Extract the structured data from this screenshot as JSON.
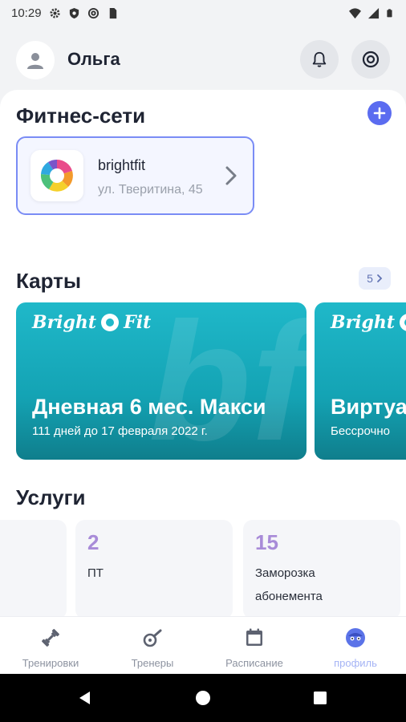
{
  "status_bar": {
    "time": "10:29"
  },
  "header": {
    "user_name": "Ольга"
  },
  "fitness": {
    "title": "Фитнес-сети",
    "club": {
      "name": "brightfit",
      "address": "ул. Тверитина, 45"
    }
  },
  "cards": {
    "title": "Карты",
    "count": "5",
    "items": [
      {
        "brand": "Bright",
        "brand2": "Fit",
        "bg_letters": "bf",
        "title": "Дневная 6 мес. Макси",
        "subtitle": "111 дней до 17 февраля 2022 г."
      },
      {
        "brand": "Bright",
        "brand2": "",
        "bg_letters": "",
        "title": "Виртуа",
        "subtitle": "Бессрочно"
      }
    ]
  },
  "services": {
    "title": "Услуги",
    "items": [
      {
        "count": "2",
        "label": "ПТ"
      },
      {
        "count": "15",
        "label": "Заморозка абонемента"
      }
    ]
  },
  "bottom_nav": {
    "items": [
      {
        "label": "Тренировки",
        "icon": "dumbbell-icon"
      },
      {
        "label": "Тренеры",
        "icon": "whistle-icon"
      },
      {
        "label": "Расписание",
        "icon": "calendar-icon"
      },
      {
        "label": "профиль",
        "icon": "profile-face-icon",
        "active": true
      }
    ]
  },
  "colors": {
    "accent": "#5b6cf0",
    "card_teal": "#1fb8c9",
    "service_number": "#a88bd8",
    "nav_active": "#a4b3f5"
  }
}
